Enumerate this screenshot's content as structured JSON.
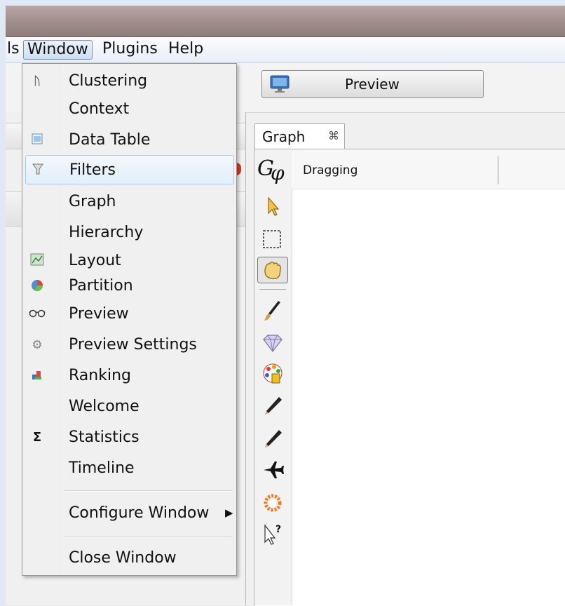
{
  "menubar": {
    "partial_item": "ls",
    "items": [
      "Window",
      "Plugins",
      "Help"
    ]
  },
  "toolbar": {
    "preview_label": "Preview"
  },
  "graph_panel": {
    "tab_label": "Graph",
    "tab_close_icon": "close-icon",
    "status_label": "Dragging",
    "tools": [
      "pointer-icon",
      "rectangle-select-icon",
      "hand-drag-icon",
      "paintbrush-icon",
      "diamond-icon",
      "color-palette-icon",
      "pencil-icon",
      "pencil-edge-icon",
      "airplane-icon",
      "spinner-icon",
      "help-cursor-icon"
    ]
  },
  "window_menu": {
    "items": [
      {
        "label": "Clustering",
        "icon": "clustering-icon"
      },
      {
        "label": "Context",
        "icon": ""
      },
      {
        "label": "Data Table",
        "icon": "data-table-icon"
      },
      {
        "label": "Filters",
        "icon": "filter-funnel-icon",
        "highlighted": true
      },
      {
        "label": "Graph",
        "icon": ""
      },
      {
        "label": "Hierarchy",
        "icon": ""
      },
      {
        "label": "Layout",
        "icon": "layout-icon"
      },
      {
        "label": "Partition",
        "icon": "partition-pie-icon"
      },
      {
        "label": "Preview",
        "icon": "glasses-icon"
      },
      {
        "label": "Preview Settings",
        "icon": "gear-icon"
      },
      {
        "label": "Ranking",
        "icon": "ranking-icon"
      },
      {
        "label": "Welcome",
        "icon": ""
      },
      {
        "label": "Statistics",
        "icon": "sigma-icon"
      },
      {
        "label": "Timeline",
        "icon": ""
      }
    ],
    "configure_label": "Configure Window",
    "close_label": "Close Window"
  },
  "colors": {
    "menu_highlight": "#dfecf9",
    "menu_highlight_border": "#a8c8ec",
    "titlebar": "#9f8c8b"
  }
}
